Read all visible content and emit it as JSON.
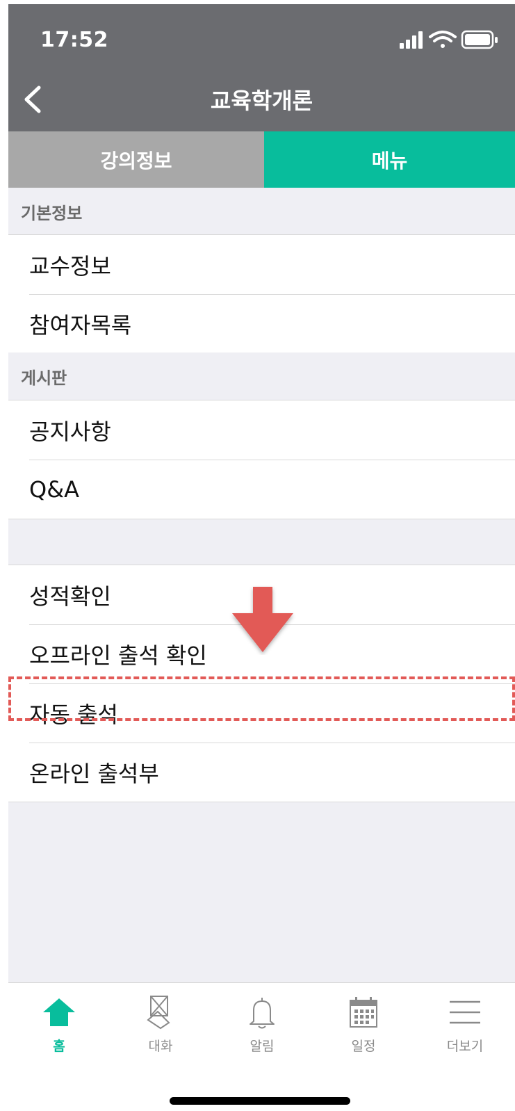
{
  "status_bar": {
    "time": "17:52"
  },
  "nav": {
    "title": "교육학개론",
    "back_icon": "chevron-left-icon"
  },
  "tabs": [
    {
      "label": "강의정보",
      "active": false
    },
    {
      "label": "메뉴",
      "active": true
    }
  ],
  "sections": [
    {
      "header": "기본정보",
      "items": [
        "교수정보",
        "참여자목록"
      ]
    },
    {
      "header": "게시판",
      "items": [
        "공지사항",
        "Q&A"
      ]
    },
    {
      "header": "",
      "items": [
        "성적확인",
        "오프라인 출석 확인",
        "자동 출석",
        "온라인 출석부"
      ]
    }
  ],
  "highlighted_item": "자동 출석",
  "bottom_tabs": [
    {
      "label": "홈",
      "icon": "home-icon",
      "active": true
    },
    {
      "label": "대화",
      "icon": "chat-icon",
      "active": false
    },
    {
      "label": "알림",
      "icon": "bell-icon",
      "active": false
    },
    {
      "label": "일정",
      "icon": "calendar-icon",
      "active": false
    },
    {
      "label": "더보기",
      "icon": "menu-icon",
      "active": false
    }
  ],
  "colors": {
    "nav_background": "#6b6c70",
    "accent": "#08bd9c",
    "inactive_tab": "#a8a8a8",
    "annotation": "#e25a57"
  }
}
